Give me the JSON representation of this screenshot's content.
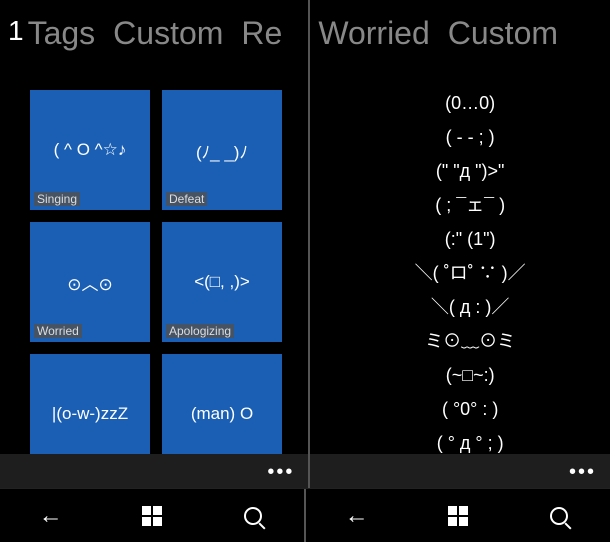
{
  "left": {
    "header": {
      "page": "1",
      "tabs": [
        "Tags",
        "Custom",
        "Re"
      ]
    },
    "tiles": [
      {
        "face": "( ^ O ^☆♪",
        "label": "Singing"
      },
      {
        "face": "(ﾉ_ _)ﾉ",
        "label": "Defeat"
      },
      {
        "face": "⊙︿⊙",
        "label": "Worried"
      },
      {
        "face": "<(□, ,)>",
        "label": "Apologizing"
      },
      {
        "face": "|(o-w-)zzZ",
        "label": ""
      },
      {
        "face": "(man) O",
        "label": ""
      }
    ]
  },
  "right": {
    "header": {
      "tabs": [
        "Worried",
        "Custom"
      ]
    },
    "list": [
      "(0…0)",
      "( -  - ; )",
      "(\" \"д \")>\"",
      "( ; ¯ェ¯ )",
      "(:\" (1\")",
      "＼( ˚ロ˚ ∵ )／",
      "＼( д  : )／",
      "ミ⊙﹏⊙ミ",
      "(~□~:)",
      "(  °0°  : )",
      "( ° д ° ; )"
    ]
  },
  "appbar": {
    "more": "•••"
  }
}
